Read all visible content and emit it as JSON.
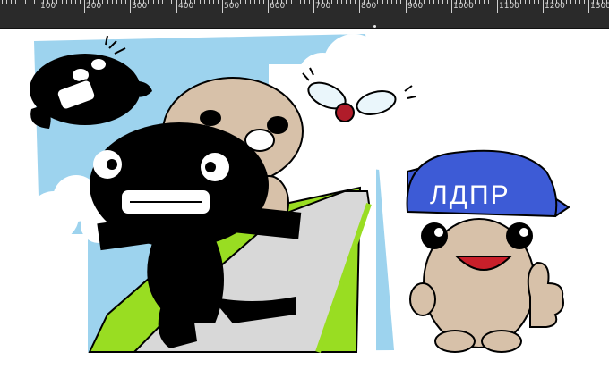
{
  "ruler": {
    "labels": [
      "100",
      "200",
      "300",
      "400",
      "500",
      "600",
      "700",
      "800",
      "900",
      "1000",
      "1100",
      "1200",
      "1300"
    ]
  },
  "artwork": {
    "cap_text": "ЛДПР"
  },
  "colors": {
    "ruler_bg": "#2a2a2a",
    "sky": "#9dd3ee",
    "cloud": "#ffffff",
    "grass": "#99dd22",
    "road": "#d8d8d8",
    "skin": "#d7c1a9",
    "cap": "#3d5bd6",
    "fly_body": "#b01c2a"
  },
  "icons": {
    "ruler": "ruler-ticks",
    "fly": "fly-drawing",
    "thumbs_up": "thumbs-up-drawing"
  }
}
